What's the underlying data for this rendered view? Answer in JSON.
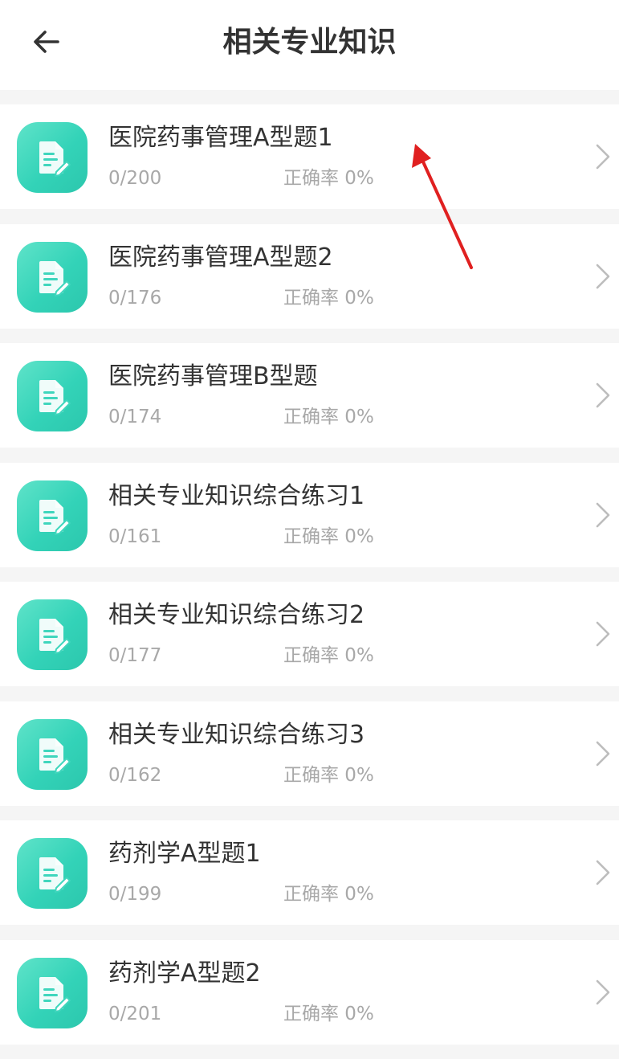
{
  "header": {
    "title": "相关专业知识",
    "back_icon": "arrow-left-icon"
  },
  "list": {
    "items": [
      {
        "title": "医院药事管理A型题1",
        "progress": "0/200",
        "accuracy": "正确率 0%"
      },
      {
        "title": "医院药事管理A型题2",
        "progress": "0/176",
        "accuracy": "正确率 0%"
      },
      {
        "title": "医院药事管理B型题",
        "progress": "0/174",
        "accuracy": "正确率 0%"
      },
      {
        "title": "相关专业知识综合练习1",
        "progress": "0/161",
        "accuracy": "正确率 0%"
      },
      {
        "title": "相关专业知识综合练习2",
        "progress": "0/177",
        "accuracy": "正确率 0%"
      },
      {
        "title": "相关专业知识综合练习3",
        "progress": "0/162",
        "accuracy": "正确率 0%"
      },
      {
        "title": "药剂学A型题1",
        "progress": "0/199",
        "accuracy": "正确率 0%"
      },
      {
        "title": "药剂学A型题2",
        "progress": "0/201",
        "accuracy": "正确率 0%"
      }
    ]
  },
  "theme": {
    "accent": "#33d3b8",
    "annotation": "#e02020"
  }
}
